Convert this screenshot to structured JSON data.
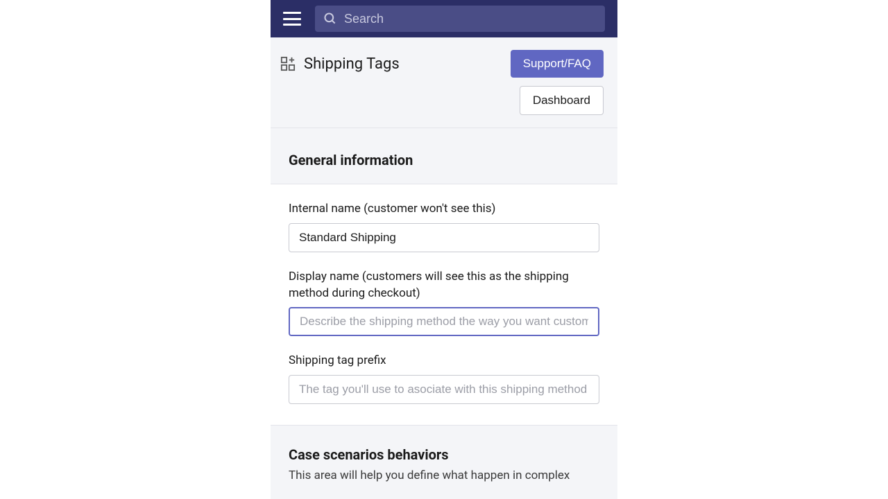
{
  "topbar": {
    "search_placeholder": "Search"
  },
  "header": {
    "page_title": "Shipping Tags",
    "support_button": "Support/FAQ",
    "dashboard_button": "Dashboard"
  },
  "section_general": {
    "title": "General information",
    "internal_name_label": "Internal name (customer won't see this)",
    "internal_name_value": "Standard Shipping",
    "display_name_label": "Display name (customers will see this as the shipping method during checkout)",
    "display_name_value": "",
    "display_name_placeholder": "Describe the shipping method the way you want customers to see it",
    "prefix_label": "Shipping tag prefix",
    "prefix_value": "",
    "prefix_placeholder": "The tag you'll use to asociate with this shipping method"
  },
  "section_cases": {
    "title": "Case scenarios behaviors",
    "description": "This area will help you define what happen in complex"
  }
}
